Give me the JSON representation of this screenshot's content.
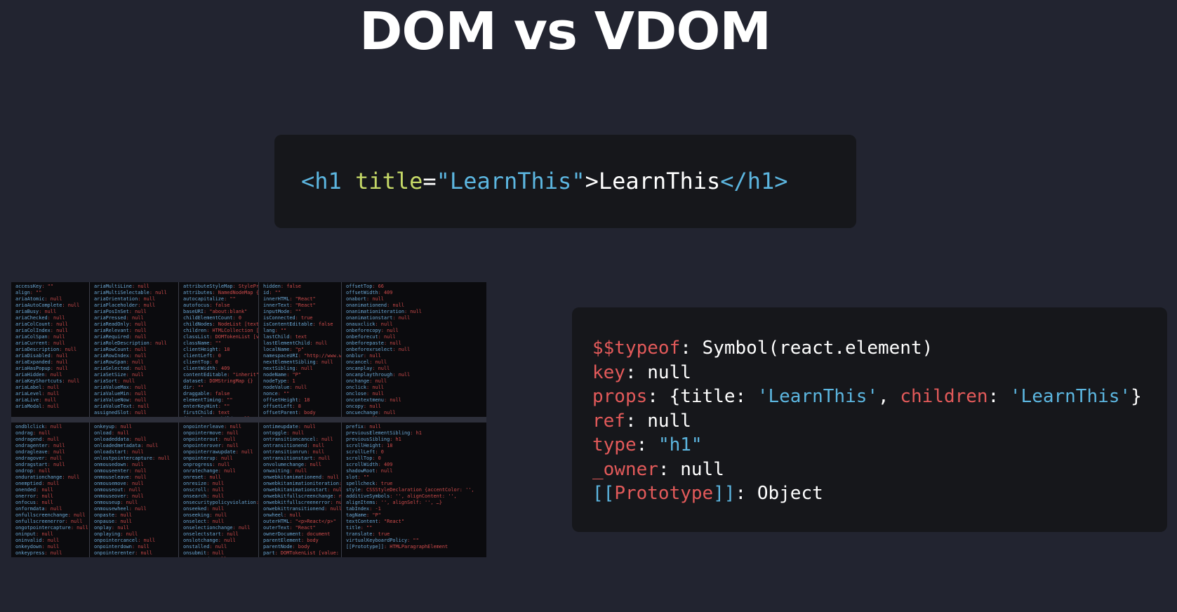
{
  "title": "DOM vs VDOM",
  "html_snippet": {
    "open_bracket": "<",
    "tag": "h1",
    "attr_name": "title",
    "equals": "=",
    "attr_value": "\"LearnThis\"",
    "close_bracket": ">",
    "text": "LearnThis",
    "end_tag": "</h1>"
  },
  "devtools_panel": {
    "row1": [
      [
        [
          "accessKey",
          ": \"\""
        ],
        [
          "align",
          ": \"\""
        ],
        [
          "ariaAtomic",
          ": null"
        ],
        [
          "ariaAutoComplete",
          ": null"
        ],
        [
          "ariaBusy",
          ": null"
        ],
        [
          "ariaChecked",
          ": null"
        ],
        [
          "ariaColCount",
          ": null"
        ],
        [
          "ariaColIndex",
          ": null"
        ],
        [
          "ariaColSpan",
          ": null"
        ],
        [
          "ariaCurrent",
          ": null"
        ],
        [
          "ariaDescription",
          ": null"
        ],
        [
          "ariaDisabled",
          ": null"
        ],
        [
          "ariaExpanded",
          ": null"
        ],
        [
          "ariaHasPopup",
          ": null"
        ],
        [
          "ariaHidden",
          ": null"
        ],
        [
          "ariaKeyShortcuts",
          ": null"
        ],
        [
          "ariaLabel",
          ": null"
        ],
        [
          "ariaLevel",
          ": null"
        ],
        [
          "ariaLive",
          ": null"
        ],
        [
          "ariaModal",
          ": null"
        ]
      ],
      [
        [
          "ariaMultiLine",
          ": null"
        ],
        [
          "ariaMultiSelectable",
          ": null"
        ],
        [
          "ariaOrientation",
          ": null"
        ],
        [
          "ariaPlaceholder",
          ": null"
        ],
        [
          "ariaPosInSet",
          ": null"
        ],
        [
          "ariaPressed",
          ": null"
        ],
        [
          "ariaReadOnly",
          ": null"
        ],
        [
          "ariaRelevant",
          ": null"
        ],
        [
          "ariaRequired",
          ": null"
        ],
        [
          "ariaRoleDescription",
          ": null"
        ],
        [
          "ariaRowCount",
          ": null"
        ],
        [
          "ariaRowIndex",
          ": null"
        ],
        [
          "ariaRowSpan",
          ": null"
        ],
        [
          "ariaSelected",
          ": null"
        ],
        [
          "ariaSetSize",
          ": null"
        ],
        [
          "ariaSort",
          ": null"
        ],
        [
          "ariaValueMax",
          ": null"
        ],
        [
          "ariaValueMin",
          ": null"
        ],
        [
          "ariaValueNow",
          ": null"
        ],
        [
          "ariaValueText",
          ": null"
        ],
        [
          "assignedSlot",
          ": null"
        ]
      ],
      [
        [
          "attributeStyleMap",
          ": StylePr"
        ],
        [
          "attributes",
          ": NamedNodeMap {"
        ],
        [
          "autocapitalize",
          ": \"\""
        ],
        [
          "autofocus",
          ": false"
        ],
        [
          "baseURI",
          ": \"about:blank\""
        ],
        [
          "childElementCount",
          ": 0"
        ],
        [
          "childNodes",
          ": NodeList [text"
        ],
        [
          "children",
          ": HTMLCollection ["
        ],
        [
          "classList",
          ": DOMTokenList [v"
        ],
        [
          "className",
          ": \"\""
        ],
        [
          "clientHeight",
          ": 18"
        ],
        [
          "clientLeft",
          ": 0"
        ],
        [
          "clientTop",
          ": 0"
        ],
        [
          "clientWidth",
          ": 409"
        ],
        [
          "contentEditable",
          ": \"inherit\""
        ],
        [
          "dataset",
          ": DOMStringMap {}"
        ],
        [
          "dir",
          ": \"\""
        ],
        [
          "draggable",
          ": false"
        ],
        [
          "elementTiming",
          ": \"\""
        ],
        [
          "enterKeyHint",
          ": \"\""
        ],
        [
          "firstChild",
          ": text"
        ],
        [
          "firstElementChild",
          ": null"
        ]
      ],
      [
        [
          "hidden",
          ": false"
        ],
        [
          "id",
          ": \"\""
        ],
        [
          "innerHTML",
          ": \"React\""
        ],
        [
          "innerText",
          ": \"React\""
        ],
        [
          "inputMode",
          ": \"\""
        ],
        [
          "isConnected",
          ": true"
        ],
        [
          "isContentEditable",
          ": false"
        ],
        [
          "lang",
          ": \"\""
        ],
        [
          "lastChild",
          ": text"
        ],
        [
          "lastElementChild",
          ": null"
        ],
        [
          "localName",
          ": \"p\""
        ],
        [
          "namespaceURI",
          ": \"http://www.w"
        ],
        [
          "nextElementSibling",
          ": null"
        ],
        [
          "nextSibling",
          ": null"
        ],
        [
          "nodeName",
          ": \"P\""
        ],
        [
          "nodeType",
          ": 1"
        ],
        [
          "nodeValue",
          ": null"
        ],
        [
          "nonce",
          ": \"\""
        ],
        [
          "offsetHeight",
          ": 18"
        ],
        [
          "offsetLeft",
          ": 8"
        ],
        [
          "offsetParent",
          ": body"
        ]
      ],
      [
        [
          "offsetTop",
          ": 66"
        ],
        [
          "offsetWidth",
          ": 409"
        ],
        [
          "onabort",
          ": null"
        ],
        [
          "onanimationend",
          ": null"
        ],
        [
          "onanimationiteration",
          ": null"
        ],
        [
          "onanimationstart",
          ": null"
        ],
        [
          "onauxclick",
          ": null"
        ],
        [
          "onbeforecopy",
          ": null"
        ],
        [
          "onbeforecut",
          ": null"
        ],
        [
          "onbeforepaste",
          ": null"
        ],
        [
          "onbeforexrselect",
          ": null"
        ],
        [
          "onblur",
          ": null"
        ],
        [
          "oncancel",
          ": null"
        ],
        [
          "oncanplay",
          ": null"
        ],
        [
          "oncanplaythrough",
          ": null"
        ],
        [
          "onchange",
          ": null"
        ],
        [
          "onclick",
          ": null"
        ],
        [
          "onclose",
          ": null"
        ],
        [
          "oncontextmenu",
          ": null"
        ],
        [
          "oncopy",
          ": null"
        ],
        [
          "oncuechange",
          ": null"
        ],
        [
          "oncut",
          ": null"
        ]
      ]
    ],
    "row2": [
      [
        [
          "ondblclick",
          ": null"
        ],
        [
          "ondrag",
          ": null"
        ],
        [
          "ondragend",
          ": null"
        ],
        [
          "ondragenter",
          ": null"
        ],
        [
          "ondragleave",
          ": null"
        ],
        [
          "ondragover",
          ": null"
        ],
        [
          "ondragstart",
          ": null"
        ],
        [
          "ondrop",
          ": null"
        ],
        [
          "ondurationchange",
          ": null"
        ],
        [
          "onemptied",
          ": null"
        ],
        [
          "onended",
          ": null"
        ],
        [
          "onerror",
          ": null"
        ],
        [
          "onfocus",
          ": null"
        ],
        [
          "onformdata",
          ": null"
        ],
        [
          "onfullscreenchange",
          ": null"
        ],
        [
          "onfullscreenerror",
          ": null"
        ],
        [
          "ongotpointercapture",
          ": null"
        ],
        [
          "oninput",
          ": null"
        ],
        [
          "oninvalid",
          ": null"
        ],
        [
          "onkeydown",
          ": null"
        ],
        [
          "onkeypress",
          ": null"
        ]
      ],
      [
        [
          "onkeyup",
          ": null"
        ],
        [
          "onload",
          ": null"
        ],
        [
          "onloadeddata",
          ": null"
        ],
        [
          "onloadedmetadata",
          ": null"
        ],
        [
          "onloadstart",
          ": null"
        ],
        [
          "onlostpointercapture",
          ": null"
        ],
        [
          "onmousedown",
          ": null"
        ],
        [
          "onmouseenter",
          ": null"
        ],
        [
          "onmouseleave",
          ": null"
        ],
        [
          "onmousemove",
          ": null"
        ],
        [
          "onmouseout",
          ": null"
        ],
        [
          "onmouseover",
          ": null"
        ],
        [
          "onmouseup",
          ": null"
        ],
        [
          "onmousewheel",
          ": null"
        ],
        [
          "onpaste",
          ": null"
        ],
        [
          "onpause",
          ": null"
        ],
        [
          "onplay",
          ": null"
        ],
        [
          "onplaying",
          ": null"
        ],
        [
          "onpointercancel",
          ": null"
        ],
        [
          "onpointerdown",
          ": null"
        ],
        [
          "onpointerenter",
          ": null"
        ]
      ],
      [
        [
          "onpointerleave",
          ": null"
        ],
        [
          "onpointermove",
          ": null"
        ],
        [
          "onpointerout",
          ": null"
        ],
        [
          "onpointerover",
          ": null"
        ],
        [
          "onpointerrawupdate",
          ": null"
        ],
        [
          "onpointerup",
          ": null"
        ],
        [
          "onprogress",
          ": null"
        ],
        [
          "onratechange",
          ": null"
        ],
        [
          "onreset",
          ": null"
        ],
        [
          "onresize",
          ": null"
        ],
        [
          "onscroll",
          ": null"
        ],
        [
          "onsearch",
          ": null"
        ],
        [
          "onsecuritypolicyviolation",
          ": null"
        ],
        [
          "onseeked",
          ": null"
        ],
        [
          "onseeking",
          ": null"
        ],
        [
          "onselect",
          ": null"
        ],
        [
          "onselectionchange",
          ": null"
        ],
        [
          "onselectstart",
          ": null"
        ],
        [
          "onslotchange",
          ": null"
        ],
        [
          "onstalled",
          ": null"
        ],
        [
          "onsubmit",
          ": null"
        ],
        [
          "onsuspend",
          ": null"
        ]
      ],
      [
        [
          "ontimeupdate",
          ": null"
        ],
        [
          "ontoggle",
          ": null"
        ],
        [
          "ontransitioncancel",
          ": null"
        ],
        [
          "ontransitionend",
          ": null"
        ],
        [
          "ontransitionrun",
          ": null"
        ],
        [
          "ontransitionstart",
          ": null"
        ],
        [
          "onvolumechange",
          ": null"
        ],
        [
          "onwaiting",
          ": null"
        ],
        [
          "onwebkitanimationend",
          ": null"
        ],
        [
          "onwebkitanimationiteration",
          ": null"
        ],
        [
          "onwebkitanimationstart",
          ": null"
        ],
        [
          "onwebkitfullscreenchange",
          ": null"
        ],
        [
          "onwebkitfullscreenerror",
          ": null"
        ],
        [
          "onwebkittransitionend",
          ": null"
        ],
        [
          "onwheel",
          ": null"
        ],
        [
          "outerHTML",
          ": \"<p>React</p>\""
        ],
        [
          "outerText",
          ": \"React\""
        ],
        [
          "ownerDocument",
          ": document"
        ],
        [
          "parentElement",
          ": body"
        ],
        [
          "parentNode",
          ": body"
        ],
        [
          "part",
          ": DOMTokenList [value:"
        ]
      ],
      [
        [
          "prefix",
          ": null"
        ],
        [
          "previousElementSibling",
          ": h1"
        ],
        [
          "previousSibling",
          ": h1"
        ],
        [
          "scrollHeight",
          ": 18"
        ],
        [
          "scrollLeft",
          ": 0"
        ],
        [
          "scrollTop",
          ": 0"
        ],
        [
          "scrollWidth",
          ": 409"
        ],
        [
          "shadowRoot",
          ": null"
        ],
        [
          "slot",
          ": \"\""
        ],
        [
          "spellcheck",
          ": true"
        ],
        [
          "style",
          ": CSSStyleDeclaration {accentColor: '',"
        ],
        [
          "additiveSymbols",
          ": '', alignContent: '',"
        ],
        [
          "alignItems",
          ": '', alignSelf: '', …}"
        ],
        [
          "tabIndex",
          ": -1"
        ],
        [
          "tagName",
          ": \"P\""
        ],
        [
          "textContent",
          ": \"React\""
        ],
        [
          "title",
          ": \"\""
        ],
        [
          "translate",
          ": true"
        ],
        [
          "virtualKeyboardPolicy",
          ": \"\""
        ],
        [
          "[[Prototype]]",
          ": HTMLParagraphElement"
        ]
      ]
    ]
  },
  "vdom_object": {
    "typeof_key": "$$typeof",
    "typeof_value": "Symbol(react.element)",
    "key_key": "key",
    "key_value": "null",
    "props_key": "props",
    "props_open": "{",
    "props_title_key": "title",
    "props_title_value": "'LearnThis'",
    "props_comma": ", ",
    "props_children_key": "children",
    "props_children_value": "'LearnThis'",
    "props_close": "}",
    "ref_key": "ref",
    "ref_value": "null",
    "type_key": "type",
    "type_value": "\"h1\"",
    "owner_key": "_owner",
    "owner_value": "null",
    "proto_open": "[[",
    "proto_key": "Prototype",
    "proto_close": "]]",
    "proto_value": "Object",
    "colon": ": "
  },
  "colors": {
    "background": "#222430",
    "code_panel": "#16171b",
    "keyword_blue": "#5cb6e0",
    "attr_green": "#c5d867",
    "key_red": "#e35a5a"
  }
}
